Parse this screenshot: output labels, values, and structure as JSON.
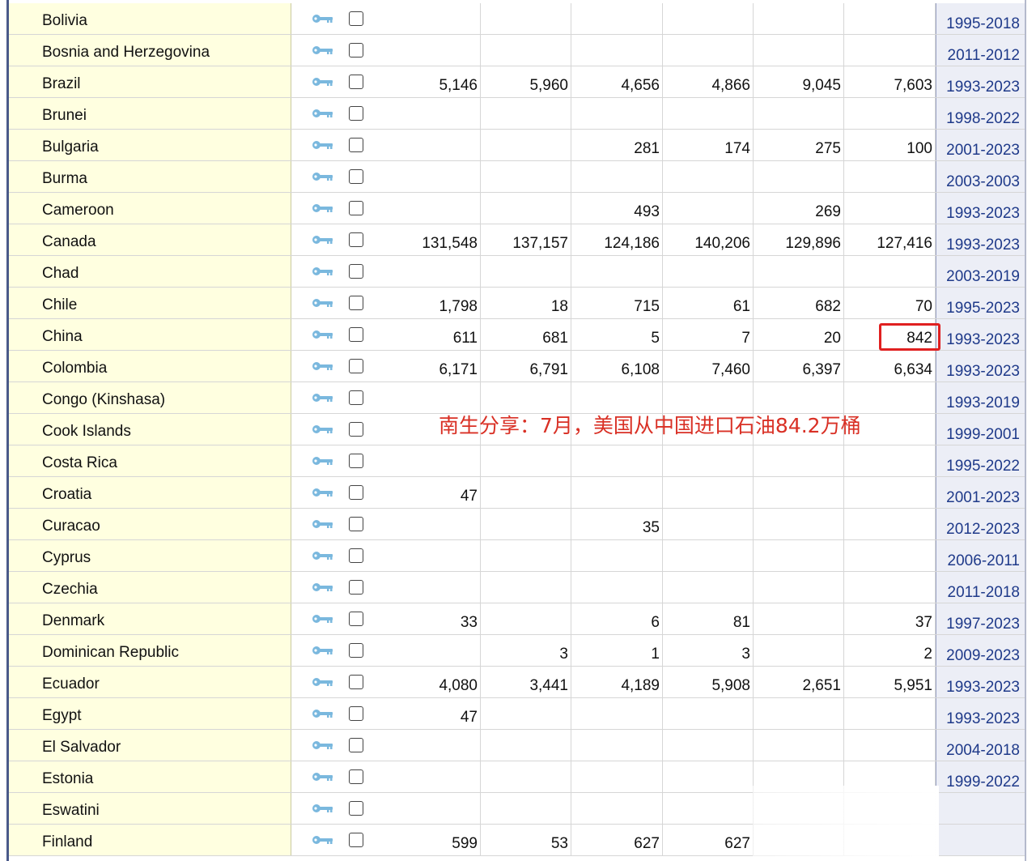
{
  "rows": [
    {
      "country": "Bolivia",
      "values": [
        "",
        "",
        "",
        "",
        "",
        ""
      ],
      "years": "1995-2018"
    },
    {
      "country": "Bosnia and Herzegovina",
      "values": [
        "",
        "",
        "",
        "",
        "",
        ""
      ],
      "years": "2011-2012"
    },
    {
      "country": "Brazil",
      "values": [
        "5,146",
        "5,960",
        "4,656",
        "4,866",
        "9,045",
        "7,603"
      ],
      "years": "1993-2023"
    },
    {
      "country": "Brunei",
      "values": [
        "",
        "",
        "",
        "",
        "",
        ""
      ],
      "years": "1998-2022"
    },
    {
      "country": "Bulgaria",
      "values": [
        "",
        "",
        "281",
        "174",
        "275",
        "100"
      ],
      "years": "2001-2023"
    },
    {
      "country": "Burma",
      "values": [
        "",
        "",
        "",
        "",
        "",
        ""
      ],
      "years": "2003-2003"
    },
    {
      "country": "Cameroon",
      "values": [
        "",
        "",
        "493",
        "",
        "269",
        ""
      ],
      "years": "1993-2023"
    },
    {
      "country": "Canada",
      "values": [
        "131,548",
        "137,157",
        "124,186",
        "140,206",
        "129,896",
        "127,416"
      ],
      "years": "1993-2023"
    },
    {
      "country": "Chad",
      "values": [
        "",
        "",
        "",
        "",
        "",
        ""
      ],
      "years": "2003-2019"
    },
    {
      "country": "Chile",
      "values": [
        "1,798",
        "18",
        "715",
        "61",
        "682",
        "70"
      ],
      "years": "1995-2023"
    },
    {
      "country": "China",
      "values": [
        "611",
        "681",
        "5",
        "7",
        "20",
        "842"
      ],
      "years": "1993-2023"
    },
    {
      "country": "Colombia",
      "values": [
        "6,171",
        "6,791",
        "6,108",
        "7,460",
        "6,397",
        "6,634"
      ],
      "years": "1993-2023"
    },
    {
      "country": "Congo (Kinshasa)",
      "values": [
        "",
        "",
        "",
        "",
        "",
        ""
      ],
      "years": "1993-2019"
    },
    {
      "country": "Cook Islands",
      "values": [
        "",
        "",
        "",
        "",
        "",
        ""
      ],
      "years": "1999-2001"
    },
    {
      "country": "Costa Rica",
      "values": [
        "",
        "",
        "",
        "",
        "",
        ""
      ],
      "years": "1995-2022"
    },
    {
      "country": "Croatia",
      "values": [
        "47",
        "",
        "",
        "",
        "",
        ""
      ],
      "years": "2001-2023"
    },
    {
      "country": "Curacao",
      "values": [
        "",
        "",
        "35",
        "",
        "",
        ""
      ],
      "years": "2012-2023"
    },
    {
      "country": "Cyprus",
      "values": [
        "",
        "",
        "",
        "",
        "",
        ""
      ],
      "years": "2006-2011"
    },
    {
      "country": "Czechia",
      "values": [
        "",
        "",
        "",
        "",
        "",
        ""
      ],
      "years": "2011-2018"
    },
    {
      "country": "Denmark",
      "values": [
        "33",
        "",
        "6",
        "81",
        "",
        "37"
      ],
      "years": "1997-2023"
    },
    {
      "country": "Dominican Republic",
      "values": [
        "",
        "3",
        "1",
        "3",
        "",
        "2"
      ],
      "years": "2009-2023"
    },
    {
      "country": "Ecuador",
      "values": [
        "4,080",
        "3,441",
        "4,189",
        "5,908",
        "2,651",
        "5,951"
      ],
      "years": "1993-2023"
    },
    {
      "country": "Egypt",
      "values": [
        "47",
        "",
        "",
        "",
        "",
        ""
      ],
      "years": "1993-2023"
    },
    {
      "country": "El Salvador",
      "values": [
        "",
        "",
        "",
        "",
        "",
        ""
      ],
      "years": "2004-2018"
    },
    {
      "country": "Estonia",
      "values": [
        "",
        "",
        "",
        "",
        "",
        ""
      ],
      "years": "1999-2022"
    },
    {
      "country": "Eswatini",
      "values": [
        "",
        "",
        "",
        "",
        "",
        ""
      ],
      "years": ""
    },
    {
      "country": "Finland",
      "values": [
        "599",
        "53",
        "627",
        "627",
        "",
        ""
      ],
      "years": ""
    }
  ],
  "annotation": "南生分享：7月，美国从中国进口石油84.2万桶",
  "colors": {
    "name_bg": "#ffffe0",
    "years_bg": "#eceef6",
    "link": "#1f3a8a",
    "annotation": "#d93025",
    "highlight": "#e02020",
    "key_icon": "#7ab8de"
  },
  "icons": {
    "key": "key-icon",
    "checkbox": "checkbox"
  }
}
